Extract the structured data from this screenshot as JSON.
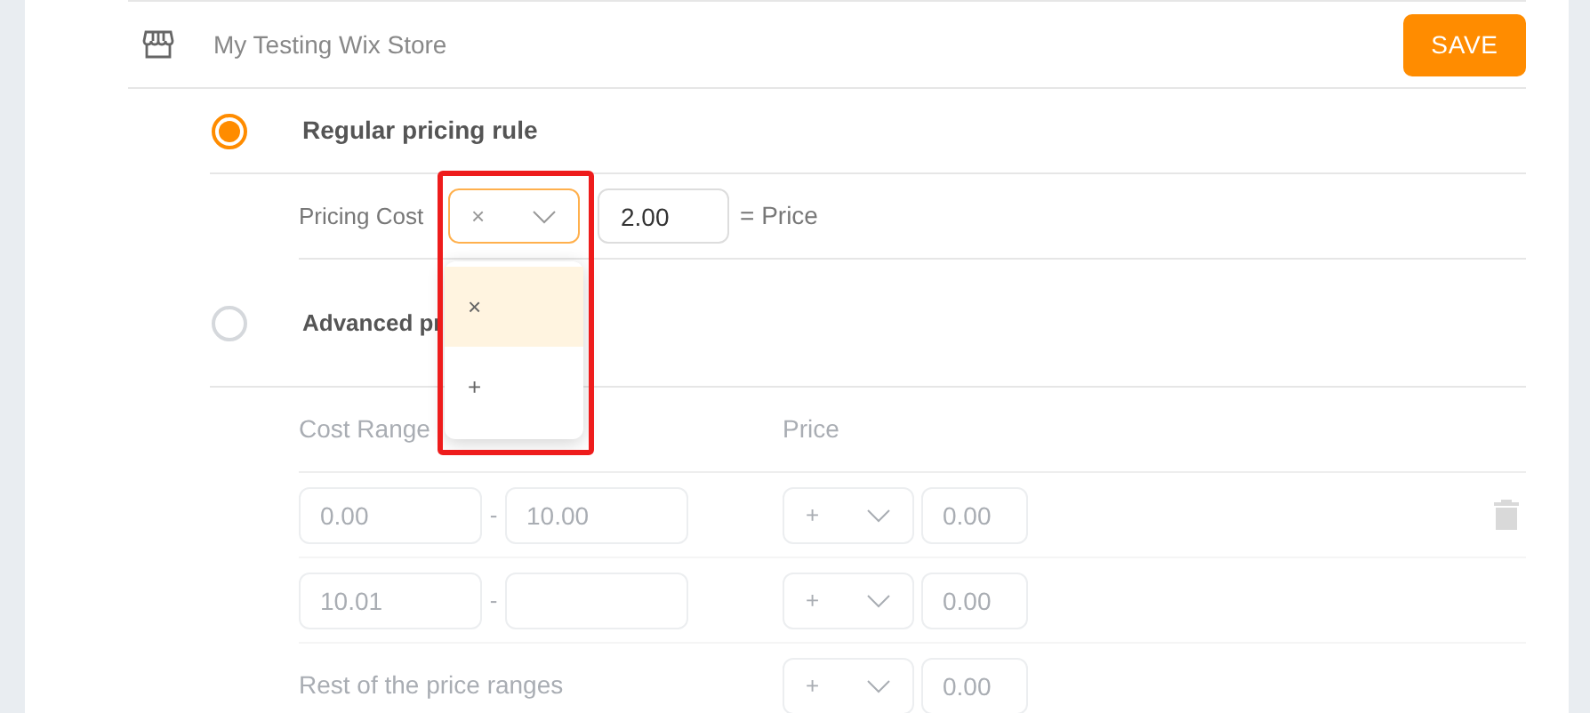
{
  "store": {
    "name": "My Testing Wix Store"
  },
  "save_button": "SAVE",
  "rules": [
    {
      "label": "Regular pricing rule",
      "selected": true
    },
    {
      "label": "Advanced pr",
      "selected": false
    }
  ],
  "regular": {
    "label": "Pricing Cost",
    "operator": "×",
    "value": "2.00",
    "result": "= Price",
    "dropdown": {
      "open": true,
      "highlighted_by_frame": true,
      "options": [
        {
          "label": "×",
          "selected": true
        },
        {
          "label": "+",
          "selected": false
        }
      ]
    }
  },
  "advanced": {
    "disabled": true,
    "columns": [
      "Cost Range",
      "Price"
    ],
    "rows": [
      {
        "kind": "range",
        "from": "0.00",
        "separator": "-",
        "to": "10.00",
        "operator": "+",
        "value": "0.00",
        "deletable": true
      },
      {
        "kind": "range",
        "from": "10.01",
        "separator": "-",
        "to": "",
        "operator": "+",
        "value": "0.00",
        "deletable": false
      },
      {
        "kind": "rest",
        "label": "Rest of the price ranges",
        "operator": "+",
        "value": "0.00",
        "deletable": false
      }
    ]
  }
}
